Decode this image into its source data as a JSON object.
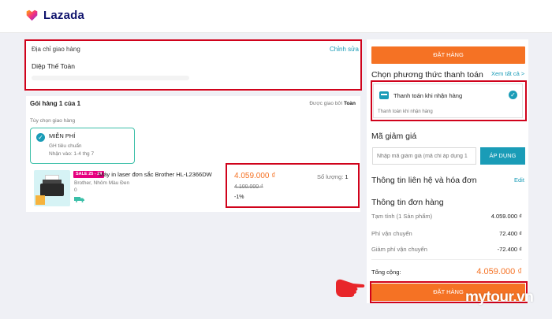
{
  "brand": {
    "name": "Lazada"
  },
  "address": {
    "title": "Địa chỉ giao hàng",
    "edit": "Chỉnh sửa",
    "name": "Diệp Thế Toàn"
  },
  "package": {
    "title": "Gói hàng 1 của 1",
    "shipped_by_label": "Được giao bởi",
    "shipped_by": "Toàn",
    "ship_option_label": "Tùy chọn giao hàng",
    "ship_option": {
      "title": "MIỄN PHÍ",
      "type": "GH tiêu chuẩn",
      "eta": "Nhận vào: 1-4 thg 7"
    }
  },
  "product": {
    "badge": "SALE 25 - 29",
    "name": "Máy in laser đơn sắc Brother HL-L2366DW",
    "variant": "Brother, Nhôm Màu Đen",
    "count": "0",
    "price": "4.059.000 ₫",
    "original_price": "4.100.000 ₫",
    "discount": "-1%",
    "qty_label": "Số lượng:",
    "qty": "1"
  },
  "order": {
    "button_label": "ĐẶT HÀNG",
    "payment_heading": "Chọn phương thức thanh toán",
    "payment_see_all": "Xem tất cả >",
    "payment_method": "Thanh toán khi nhận hàng",
    "payment_sub": "Thanh toán khi nhận hàng",
    "voucher_heading": "Mã giảm giá",
    "voucher_placeholder": "Nhập mã giảm giá (mã chỉ áp dụng 1",
    "voucher_apply": "ÁP DỤNG",
    "contact_heading": "Thông tin liên hệ và hóa đơn",
    "contact_edit": "Edit",
    "summary_heading": "Thông tin đơn hàng",
    "rows": [
      {
        "label": "Tạm tính (1 Sản phẩm)",
        "value": "4.059.000 ₫"
      },
      {
        "label": "Phí vận chuyển",
        "value": "72.400 ₫"
      },
      {
        "label": "Giảm phí vận chuyển",
        "value": "-72.400 ₫"
      }
    ],
    "total_label": "Tổng cộng:",
    "total_value": "4.059.000 ₫"
  },
  "watermark": "mytour.vn",
  "colors": {
    "accent": "#f57224",
    "link": "#1a9cb7",
    "highlight": "#d0021b"
  }
}
